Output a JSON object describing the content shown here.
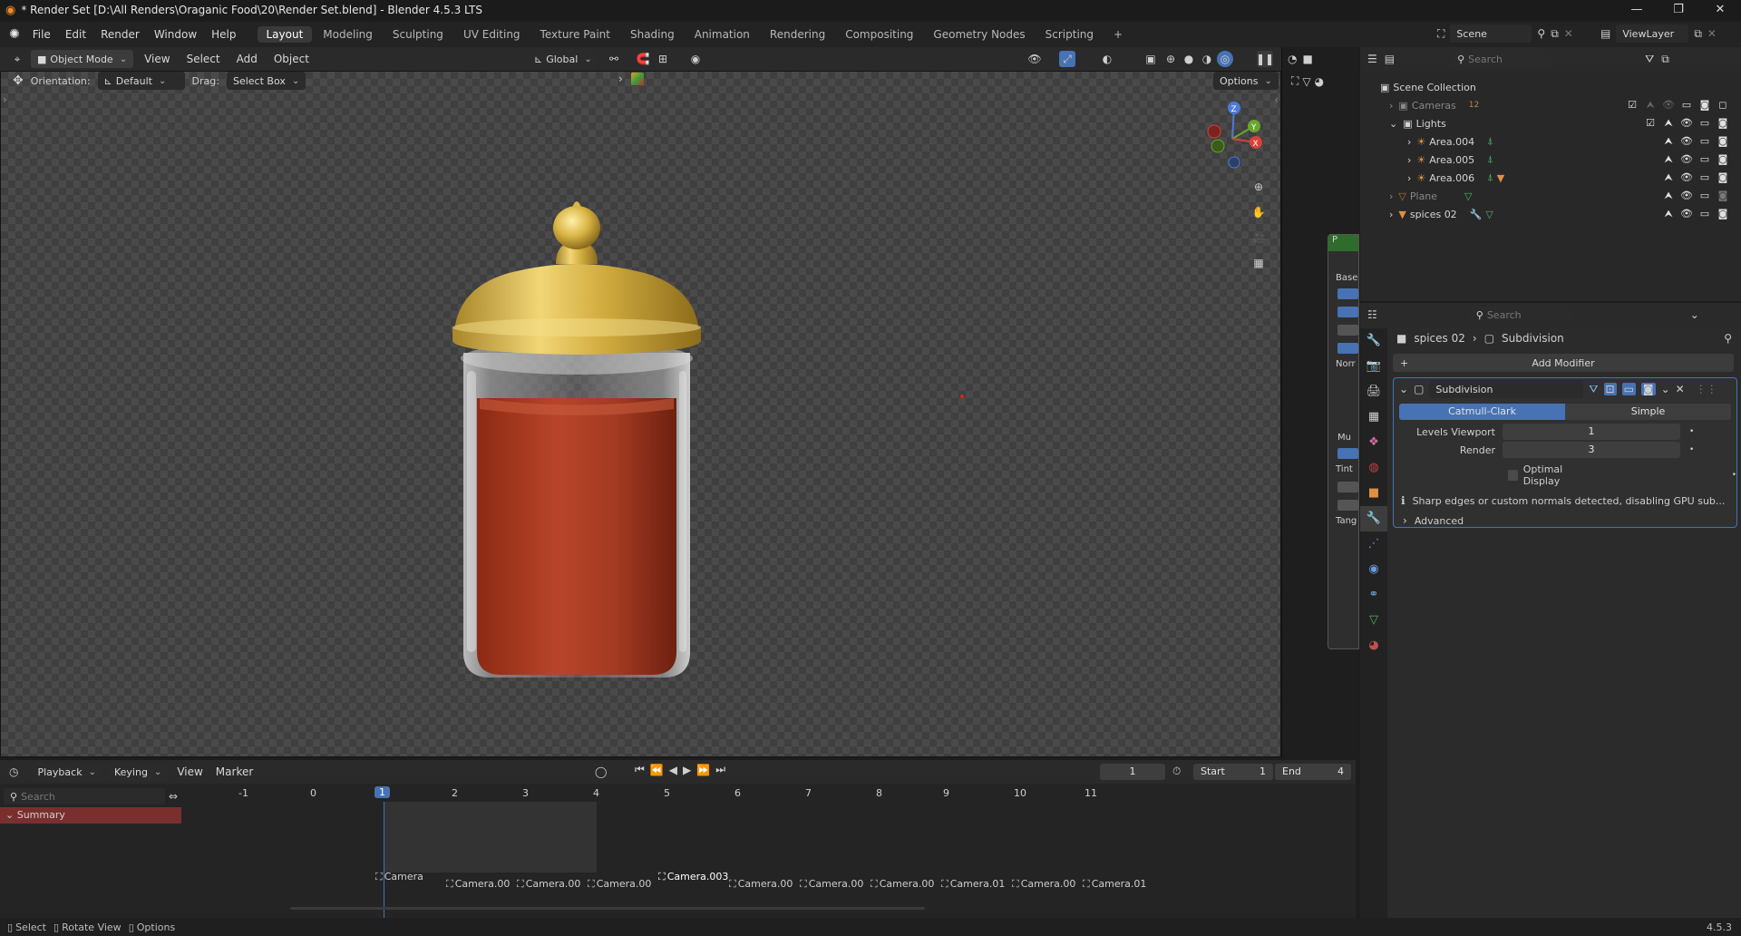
{
  "titlebar": {
    "title": "* Render Set [D:\\All Renders\\Oraganic Food\\20\\Render Set.blend] - Blender 4.5.3 LTS",
    "minimize": "—",
    "maximize": "❐",
    "close": "✕"
  },
  "menu": {
    "items": [
      "File",
      "Edit",
      "Render",
      "Window",
      "Help"
    ]
  },
  "workspaces": {
    "tabs": [
      "Layout",
      "Modeling",
      "Sculpting",
      "UV Editing",
      "Texture Paint",
      "Shading",
      "Animation",
      "Rendering",
      "Compositing",
      "Geometry Nodes",
      "Scripting"
    ],
    "active": "Layout",
    "add": "+"
  },
  "scene": {
    "label": "Scene",
    "viewlayer": "ViewLayer"
  },
  "view3d_header": {
    "mode": "Object Mode",
    "menus": [
      "View",
      "Select",
      "Add",
      "Object"
    ],
    "transform_orientation": "Global"
  },
  "tool_settings": {
    "orientation_label": "Orientation:",
    "orientation_value": "Default",
    "drag_label": "Drag:",
    "drag_value": "Select Box",
    "options": "Options"
  },
  "navigation_gizmo": {
    "z": "Z",
    "y": "Y",
    "x": "X"
  },
  "outliner": {
    "search_placeholder": "Search",
    "root": "Scene Collection",
    "rows": [
      {
        "name": "Cameras",
        "badge": "12"
      },
      {
        "name": "Lights"
      },
      {
        "name": "Area.004"
      },
      {
        "name": "Area.005"
      },
      {
        "name": "Area.006"
      },
      {
        "name": "Plane"
      },
      {
        "name": "spices 02"
      }
    ]
  },
  "node_fragment": {
    "labels": [
      "P",
      "Base",
      "Norr",
      "Mu",
      "Tint",
      "Tang"
    ]
  },
  "properties": {
    "search_placeholder": "Search",
    "breadcrumb_object": "spices 02",
    "breadcrumb_modifier": "Subdivision",
    "add_modifier": "Add Modifier",
    "modifier": {
      "name": "Subdivision",
      "type_options": [
        "Catmull-Clark",
        "Simple"
      ],
      "active_type": "Catmull-Clark",
      "levels_viewport_label": "Levels Viewport",
      "levels_viewport": "1",
      "render_label": "Render",
      "render": "3",
      "optimal_display": "Optimal Display",
      "warning": "Sharp edges or custom normals detected, disabling GPU sub...",
      "advanced": "Advanced"
    }
  },
  "timeline": {
    "menus": [
      "Playback",
      "Keying",
      "View",
      "Marker"
    ],
    "current_frame": "1",
    "start_label": "Start",
    "start": "1",
    "end_label": "End",
    "end": "4",
    "search_placeholder": "Search",
    "summary": "Summary",
    "ruler": [
      "-1",
      "0",
      "1",
      "2",
      "3",
      "4",
      "5",
      "6",
      "7",
      "8",
      "9",
      "10",
      "11"
    ],
    "markers": [
      "Camera",
      "Camera.00",
      "Camera.00",
      "Camera.00",
      "Camera.003",
      "Camera.00",
      "Camera.00",
      "Camera.00",
      "Camera.01",
      "Camera.00",
      "Camera.01"
    ]
  },
  "statusbar": {
    "select": "Select",
    "rotate_view": "Rotate View",
    "options": "Options",
    "version": "4.5.3"
  },
  "colors": {
    "accent": "#4772b3",
    "selected_frame": "#4772b3",
    "summary_bg": "#7a2f2f",
    "gold": "#d8b440"
  }
}
